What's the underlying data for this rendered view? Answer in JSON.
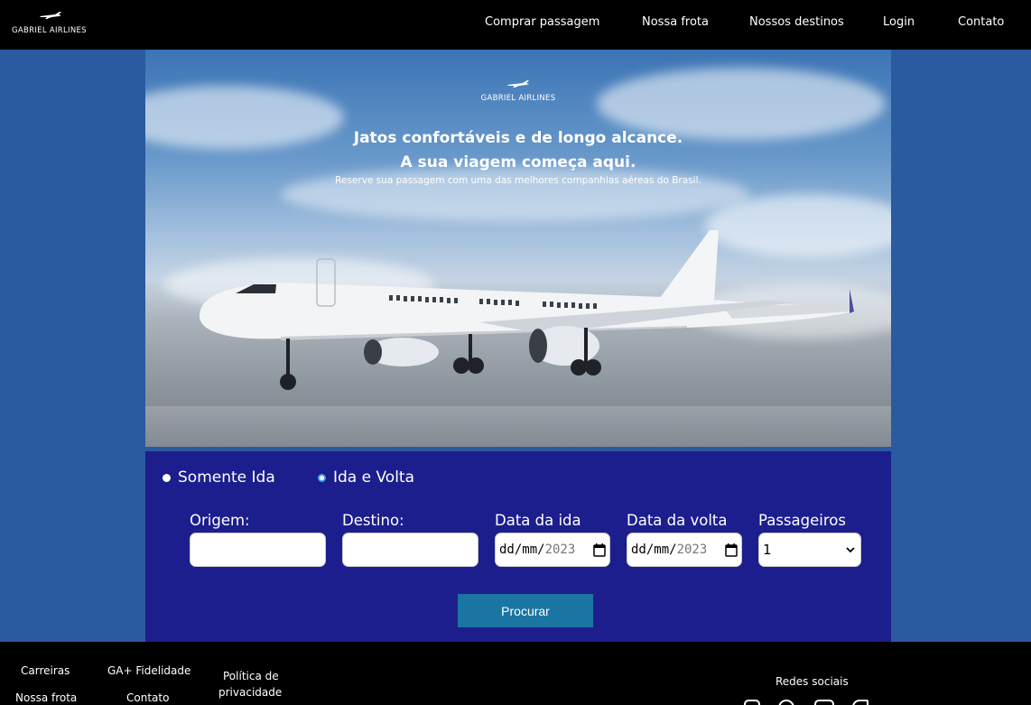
{
  "header": {
    "logo_text": "GABRIEL AIRLINES",
    "nav": [
      "Comprar passagem",
      "Nossa frota",
      "Nossos destinos",
      "Login",
      "Contato"
    ]
  },
  "hero": {
    "logo_text": "GABRIEL AIRLINES",
    "headline_1": "Jatos confortáveis e de longo alcance.",
    "headline_2": "A sua viagem começa aqui.",
    "subline": "Reserve sua passagem com uma das melhores companhias aéreas do Brasil."
  },
  "booking": {
    "trip_types": [
      {
        "label": "Somente Ida",
        "selected": false
      },
      {
        "label": "Ida e Volta",
        "selected": true
      }
    ],
    "fields": {
      "origin": {
        "label": "Origem:",
        "value": ""
      },
      "destination": {
        "label": "Destino:",
        "value": ""
      },
      "depart_date": {
        "label": "Data da ida",
        "placeholder_dm": "dd/mm/",
        "placeholder_year": "2023"
      },
      "return_date": {
        "label": "Data da volta",
        "placeholder_dm": "dd/mm/",
        "placeholder_year": "2023"
      },
      "passengers": {
        "label": "Passageiros",
        "value": "1"
      }
    },
    "search_label": "Procurar"
  },
  "footer": {
    "links": [
      "Carreiras",
      "GA+ Fidelidade",
      "Política de",
      "privacidade",
      "Nossa frota",
      "Contato"
    ],
    "social_label": "Redes sociais",
    "social_icons": [
      "instagram-icon",
      "facebook-icon",
      "youtube-icon",
      "twitter-icon"
    ]
  },
  "colors": {
    "page_bg": "#2a5aa0",
    "header_bg": "#000000",
    "booking_bg": "#1c1e8d",
    "button_bg": "#1a75a2"
  }
}
